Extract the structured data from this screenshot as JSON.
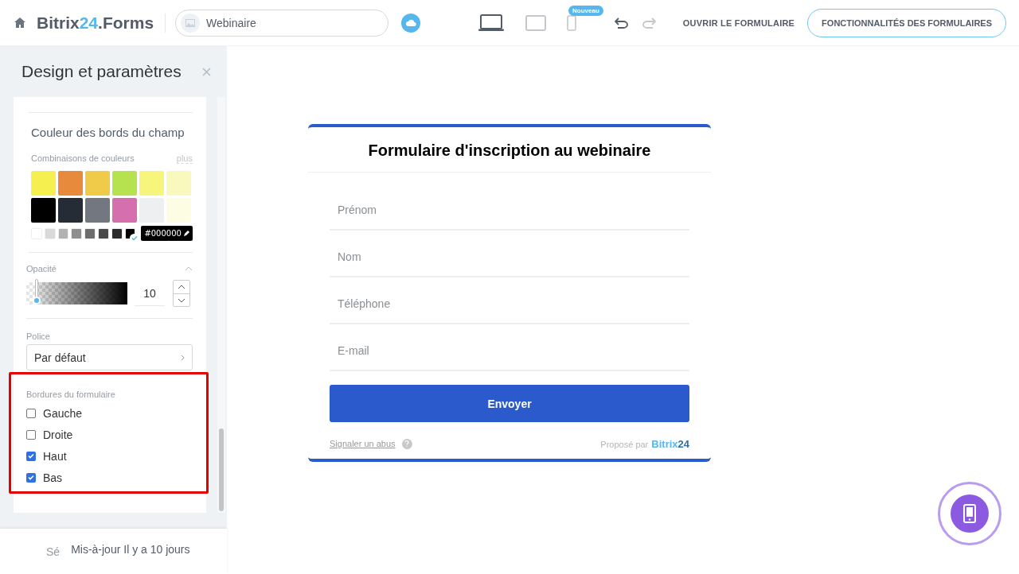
{
  "header": {
    "brand": {
      "name": "Bitrix",
      "number": "24",
      "suffix": ".Forms"
    },
    "form_name": "Webinaire",
    "devices": [
      {
        "kind": "laptop",
        "selected": true
      },
      {
        "kind": "tablet",
        "selected": false
      },
      {
        "kind": "phone",
        "selected": false,
        "badge": "Nouveau"
      }
    ],
    "undo": {
      "disabled": false
    },
    "redo": {
      "disabled": true
    },
    "open_link": "OUVRIR LE FORMULAIRE",
    "features_button": "FONCTIONNALITÉS DES FORMULAIRES"
  },
  "sidebar": {
    "title": "Design et paramètres",
    "border_color": {
      "heading": "Couleur des bords du champ",
      "combos_label": "Combinaisons de couleurs",
      "more_link": "plus",
      "swatches": [
        {
          "color": "#f5ef4f"
        },
        {
          "color": "#e78a3b"
        },
        {
          "color": "#f0cb4a"
        },
        {
          "color": "#b6e24f"
        },
        {
          "color": "#f6f57c"
        },
        {
          "color": "#f9f8bd"
        },
        {
          "color": "#000000"
        },
        {
          "color": "#262c35"
        },
        {
          "color": "#737880"
        },
        {
          "color": "#d66fae"
        },
        {
          "color": "#eeeff1"
        },
        {
          "color": "#fdfde4"
        }
      ],
      "grays": [
        {
          "color": "#ffffff",
          "selected": false
        },
        {
          "color": "#d9d9d9",
          "selected": false
        },
        {
          "color": "#b2b2b2",
          "selected": false
        },
        {
          "color": "#8e8e8e",
          "selected": false
        },
        {
          "color": "#6d6d6d",
          "selected": false
        },
        {
          "color": "#4a4a4a",
          "selected": false
        },
        {
          "color": "#2a2a2a",
          "selected": false
        },
        {
          "color": "#000000",
          "selected": true
        }
      ],
      "hex": "#000000"
    },
    "opacity": {
      "label": "Opacité",
      "level": 0.1,
      "reading": "10"
    },
    "font": {
      "label": "Police",
      "value": "Par défaut"
    },
    "borders": {
      "label": "Bordures du formulaire",
      "options": [
        {
          "label": "Gauche",
          "checked": false
        },
        {
          "label": "Droite",
          "checked": false
        },
        {
          "label": "Haut",
          "checked": true
        },
        {
          "label": "Bas",
          "checked": true
        }
      ]
    },
    "footer": {
      "partial": "Sé",
      "tooltip": "Mis-à-jour Il y a 10 jours"
    }
  },
  "preview": {
    "title": "Formulaire d'inscription au webinaire",
    "fields": [
      {
        "placeholder": "Prénom"
      },
      {
        "placeholder": "Nom"
      },
      {
        "placeholder": "Téléphone"
      },
      {
        "placeholder": "E-mail"
      }
    ],
    "submit": "Envoyer",
    "report_link": "Signaler un abus",
    "powered_by": "Proposé par",
    "powered_brand": "Bitrix",
    "powered_number": "24"
  }
}
